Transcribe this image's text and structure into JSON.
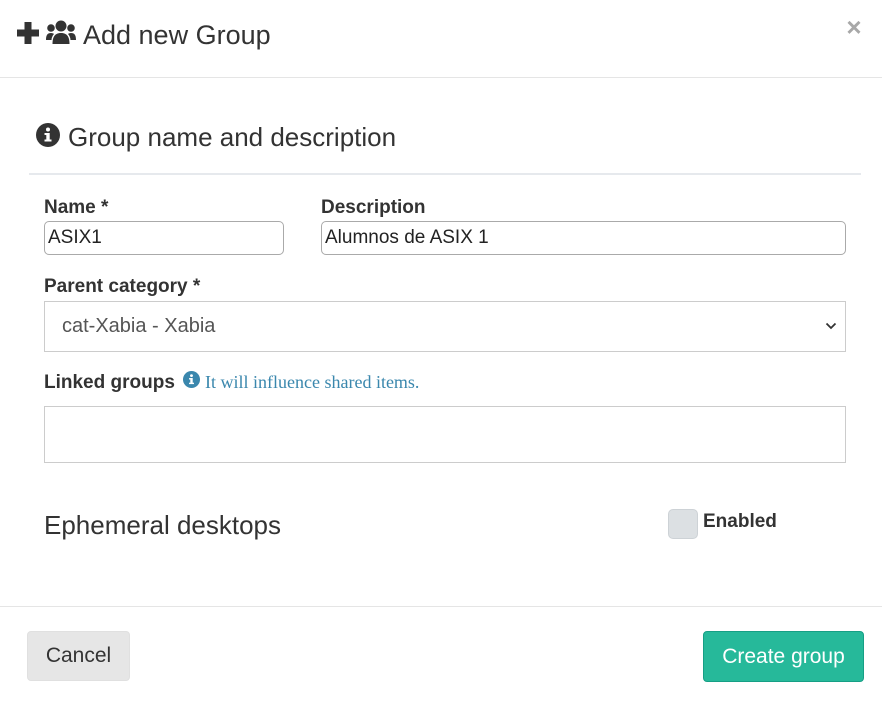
{
  "header": {
    "title": "Add new Group",
    "icons": [
      "plus-icon",
      "users-icon"
    ],
    "close_label": "×"
  },
  "section": {
    "icon": "info-circle-icon",
    "title": "Group name and description"
  },
  "form": {
    "name_label": "Name *",
    "name_value": "ASIX1",
    "description_label": "Description",
    "description_value": "Alumnos de ASIX 1",
    "parent_category_label": "Parent category *",
    "parent_category_value": "cat-Xabia - Xabia",
    "linked_groups_label": "Linked groups",
    "linked_groups_hint": "It will influence shared items.",
    "ephemeral_label": "Ephemeral desktops",
    "enabled_label": "Enabled"
  },
  "footer": {
    "cancel_label": "Cancel",
    "create_label": "Create group"
  },
  "colors": {
    "primary": "#26b99a",
    "hint": "#3a87ad",
    "text": "#333333"
  }
}
